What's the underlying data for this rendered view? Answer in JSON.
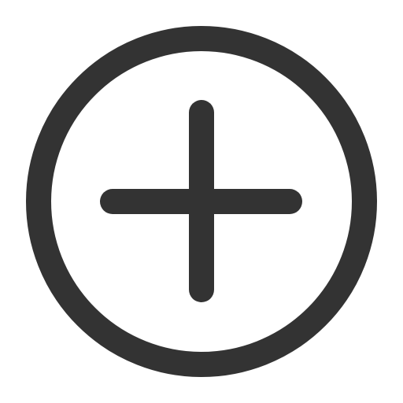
{
  "icon": {
    "name": "add-circle-icon",
    "stroke_color": "#333333",
    "background_color": "#ffffff"
  }
}
